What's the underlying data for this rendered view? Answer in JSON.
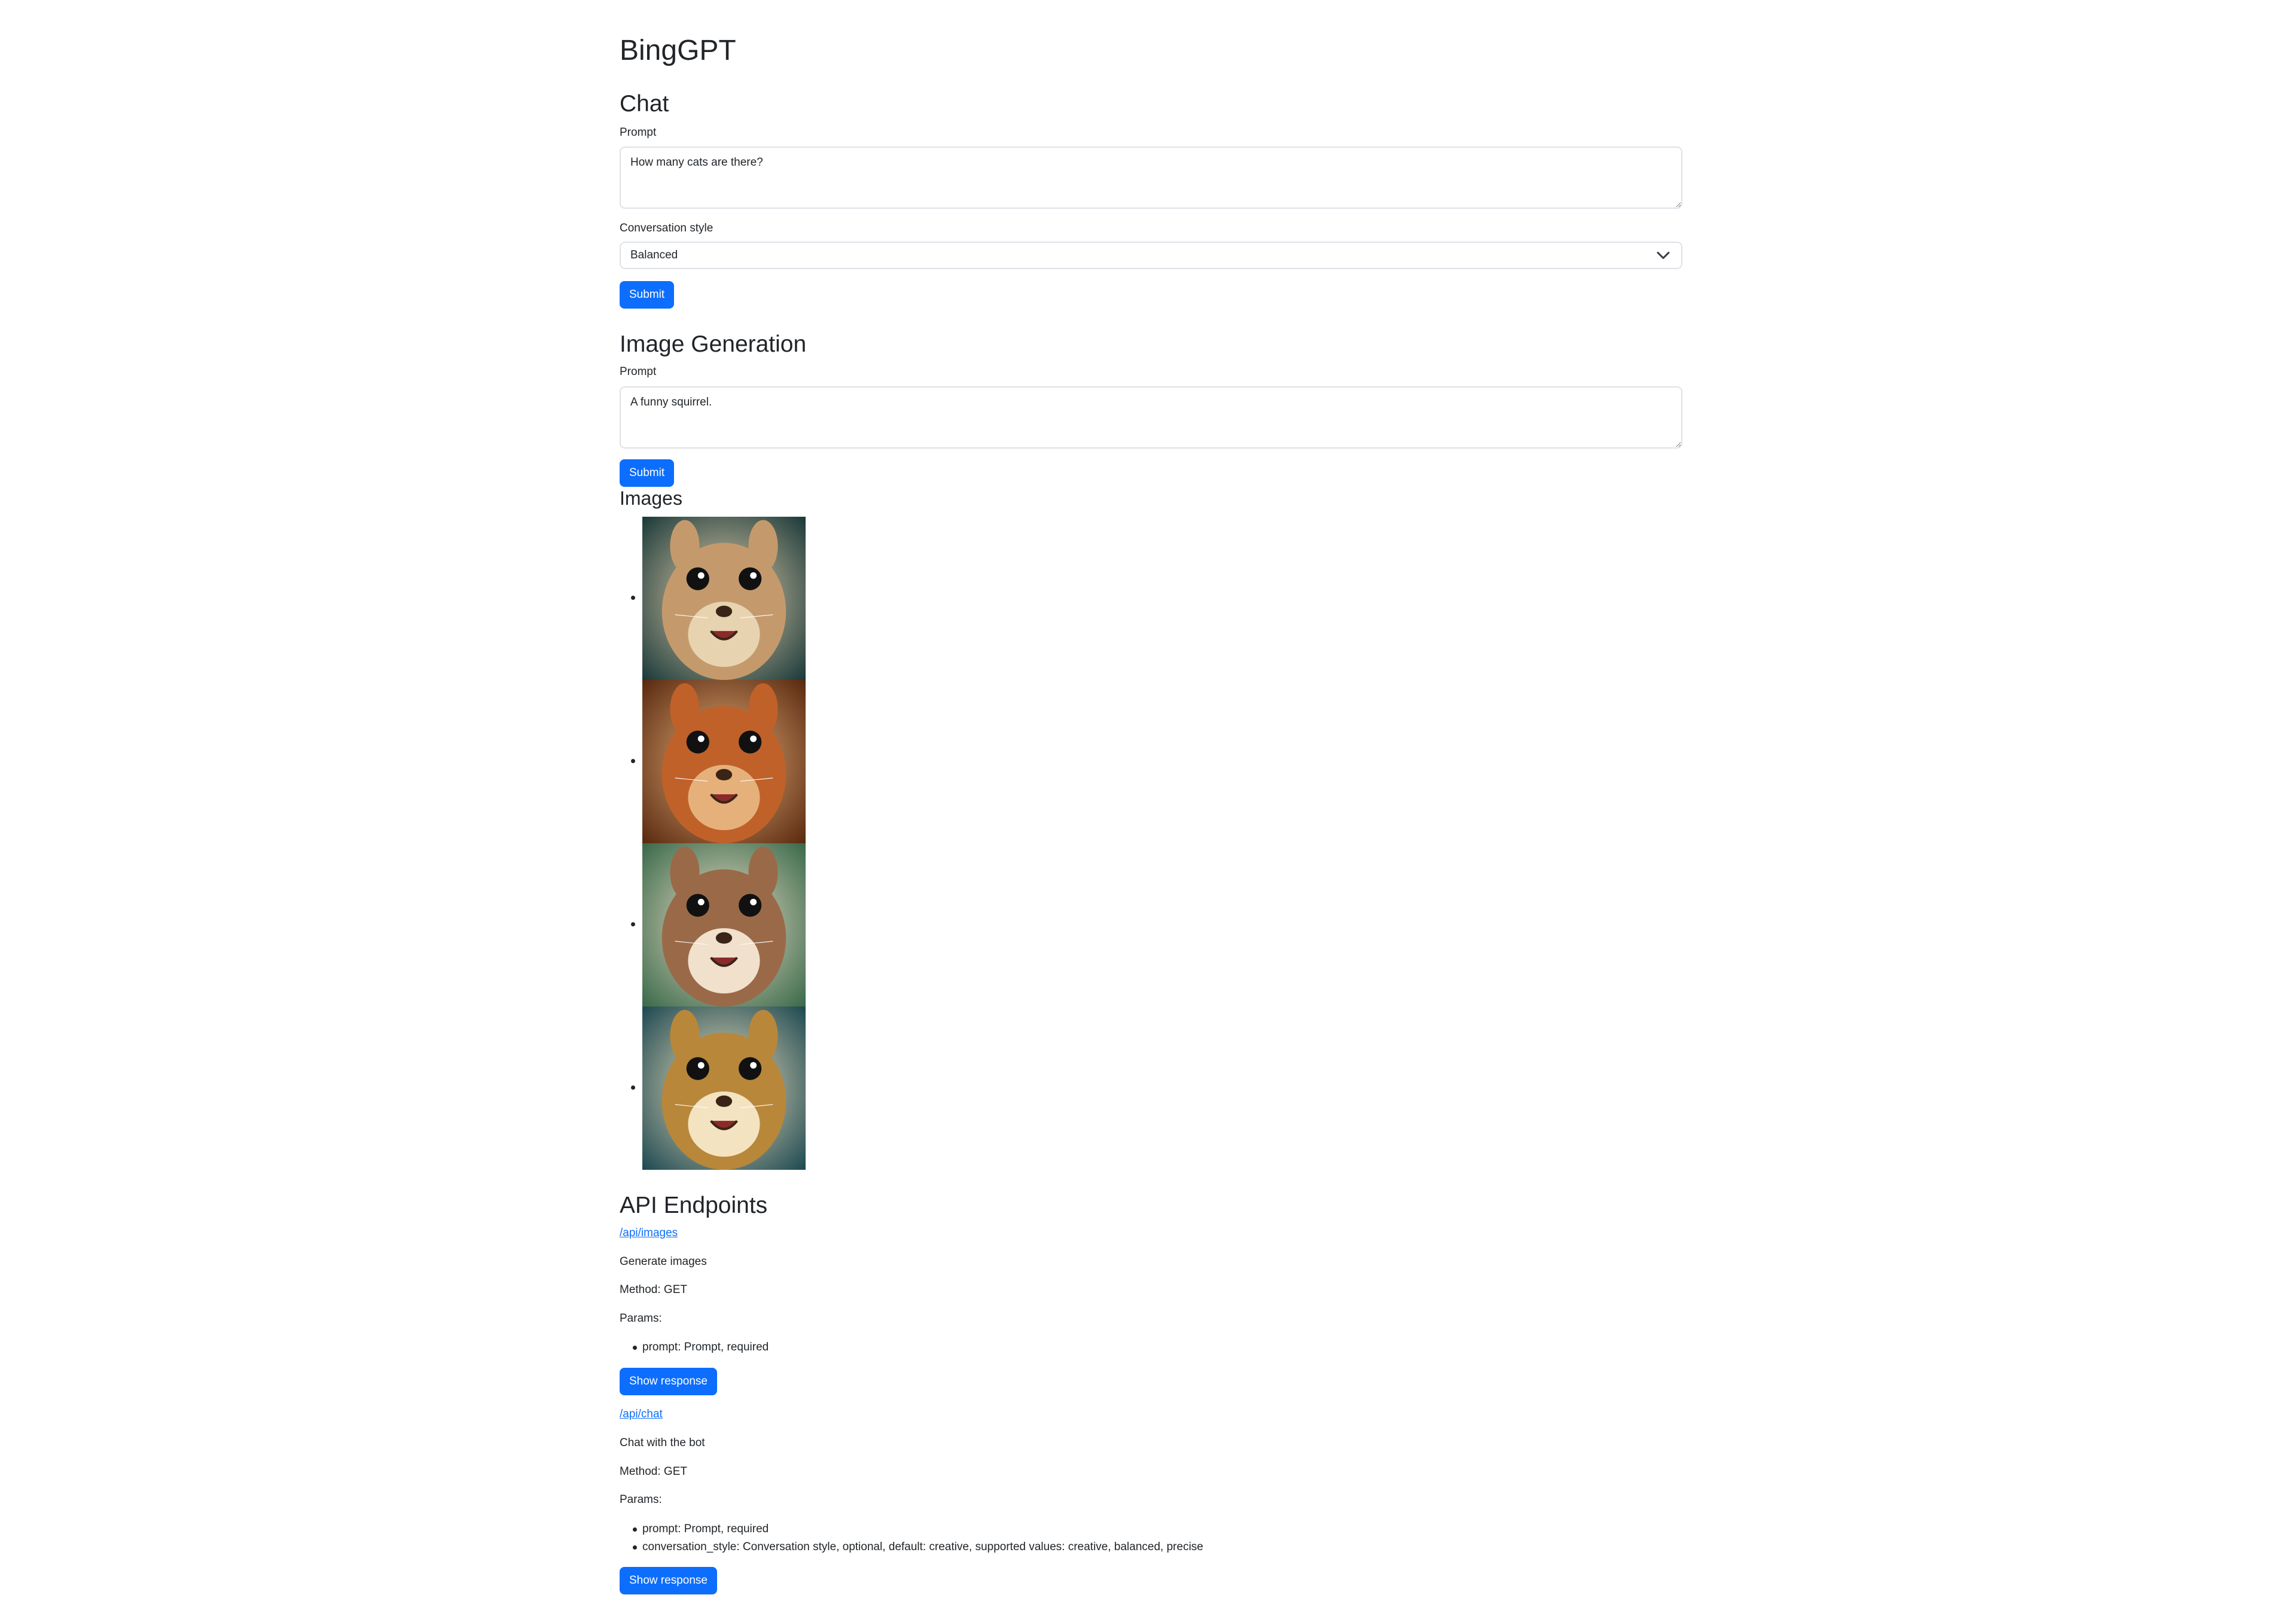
{
  "header": {
    "title": "BingGPT"
  },
  "chat": {
    "heading": "Chat",
    "prompt_label": "Prompt",
    "prompt_value": "How many cats are there?",
    "style_label": "Conversation style",
    "style_value": "Balanced",
    "submit_label": "Submit"
  },
  "image_generation": {
    "heading": "Image Generation",
    "prompt_label": "Prompt",
    "prompt_value": "A funny squirrel.",
    "submit_label": "Submit",
    "images_heading": "Images",
    "images": [
      {
        "subject": "squirrel",
        "palette": [
          "#1b3a3a",
          "#c49a6c",
          "#e8d3b0"
        ]
      },
      {
        "subject": "squirrel",
        "palette": [
          "#5a2a10",
          "#c0612a",
          "#e6b07a"
        ]
      },
      {
        "subject": "squirrel",
        "palette": [
          "#3a6a4a",
          "#9a6a48",
          "#f0e0cc"
        ]
      },
      {
        "subject": "squirrel",
        "palette": [
          "#1e4a52",
          "#b8873a",
          "#f3e3c0"
        ]
      }
    ]
  },
  "api": {
    "heading": "API Endpoints",
    "endpoints": [
      {
        "path": "/api/images",
        "description": "Generate images",
        "method": "Method: GET",
        "params_label": "Params:",
        "params": [
          "prompt: Prompt, required"
        ],
        "button": "Show response"
      },
      {
        "path": "/api/chat",
        "description": "Chat with the bot",
        "method": "Method: GET",
        "params_label": "Params:",
        "params": [
          "prompt: Prompt, required",
          "conversation_style: Conversation style, optional, default: creative, supported values: creative, balanced, precise"
        ],
        "button": "Show response"
      }
    ]
  },
  "colors": {
    "primary": "#0d6efd",
    "border": "#dee2e6",
    "text": "#212529"
  }
}
